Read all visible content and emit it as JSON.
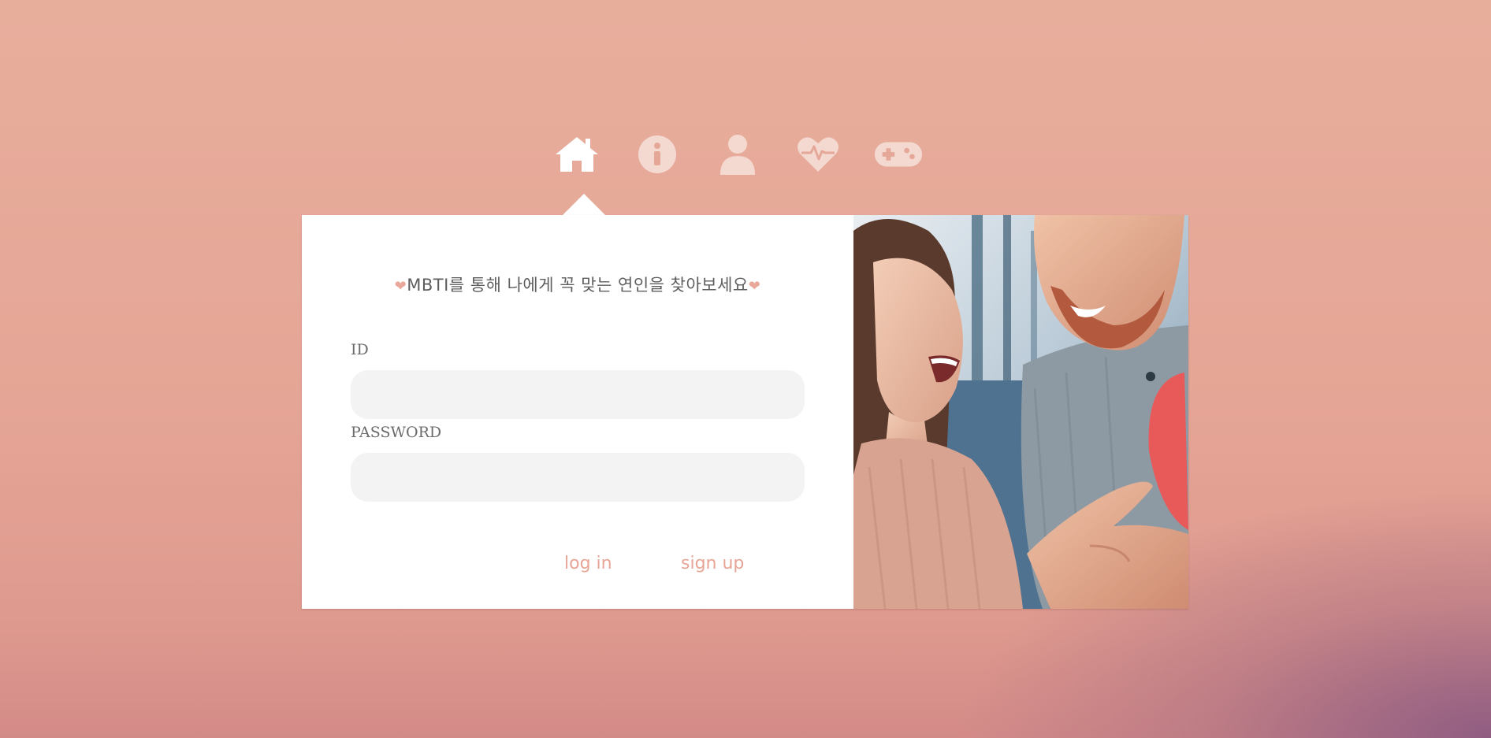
{
  "nav": {
    "items": [
      {
        "icon": "home-icon",
        "active": true
      },
      {
        "icon": "info-icon",
        "active": false
      },
      {
        "icon": "user-icon",
        "active": false
      },
      {
        "icon": "heartbeat-icon",
        "active": false
      },
      {
        "icon": "gamepad-icon",
        "active": false
      }
    ]
  },
  "login": {
    "headline_heart": "❤",
    "headline": "MBTI를 통해 나에게 꼭 맞는 연인을 찾아보세요",
    "id_label": "ID",
    "id_value": "",
    "password_label": "PASSWORD",
    "password_value": "",
    "login_label": "log in",
    "signup_label": "sign up"
  },
  "colors": {
    "accent": "#e7a597",
    "text": "#5e5e5e",
    "input_bg": "#f3f3f3",
    "background_top": "#e8ae9c",
    "background_bottom_corner": "#8c5a82"
  }
}
